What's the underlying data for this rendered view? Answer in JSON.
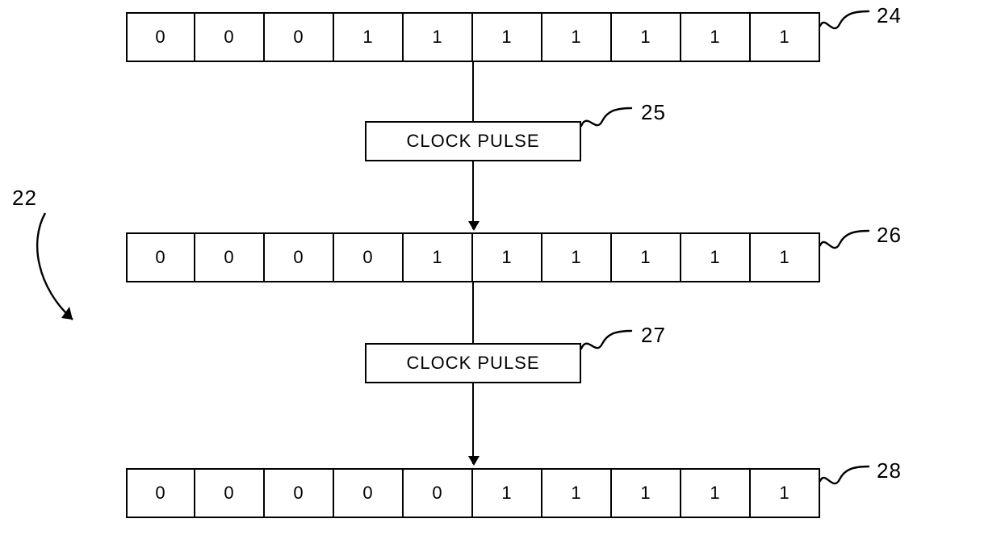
{
  "registers": {
    "r24": {
      "cells": [
        "0",
        "0",
        "0",
        "1",
        "1",
        "1",
        "1",
        "1",
        "1",
        "1"
      ],
      "ref": "24"
    },
    "r26": {
      "cells": [
        "0",
        "0",
        "0",
        "0",
        "1",
        "1",
        "1",
        "1",
        "1",
        "1"
      ],
      "ref": "26"
    },
    "r28": {
      "cells": [
        "0",
        "0",
        "0",
        "0",
        "0",
        "1",
        "1",
        "1",
        "1",
        "1"
      ],
      "ref": "28"
    }
  },
  "clock_pulses": {
    "cp25": {
      "label": "CLOCK PULSE",
      "ref": "25"
    },
    "cp27": {
      "label": "CLOCK PULSE",
      "ref": "27"
    }
  },
  "side_ref": {
    "label": "22"
  }
}
